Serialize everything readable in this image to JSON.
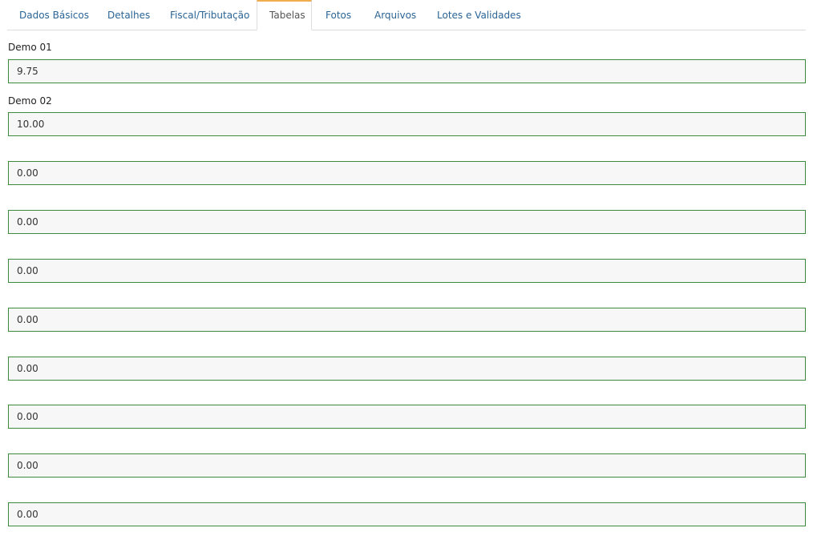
{
  "tabs": [
    {
      "label": "Dados Básicos",
      "active": false
    },
    {
      "label": "Detalhes",
      "active": false
    },
    {
      "label": "Fiscal/Tributação",
      "active": false
    },
    {
      "label": "Tabelas",
      "active": true
    },
    {
      "label": "Fotos",
      "active": false
    },
    {
      "label": "Arquivos",
      "active": false
    },
    {
      "label": "Lotes e Validades",
      "active": false
    }
  ],
  "fields": [
    {
      "label": "Demo 01",
      "value": "9.75"
    },
    {
      "label": "Demo 02",
      "value": "10.00"
    },
    {
      "label": "",
      "value": "0.00"
    },
    {
      "label": "",
      "value": "0.00"
    },
    {
      "label": "",
      "value": "0.00"
    },
    {
      "label": "",
      "value": "0.00"
    },
    {
      "label": "",
      "value": "0.00"
    },
    {
      "label": "",
      "value": "0.00"
    },
    {
      "label": "",
      "value": "0.00"
    },
    {
      "label": "",
      "value": "0.00"
    }
  ],
  "colors": {
    "link": "#2a6496",
    "active_tab_accent": "#f0ad4e",
    "input_border": "#3c8a3c",
    "input_background": "#f6f7f6"
  }
}
